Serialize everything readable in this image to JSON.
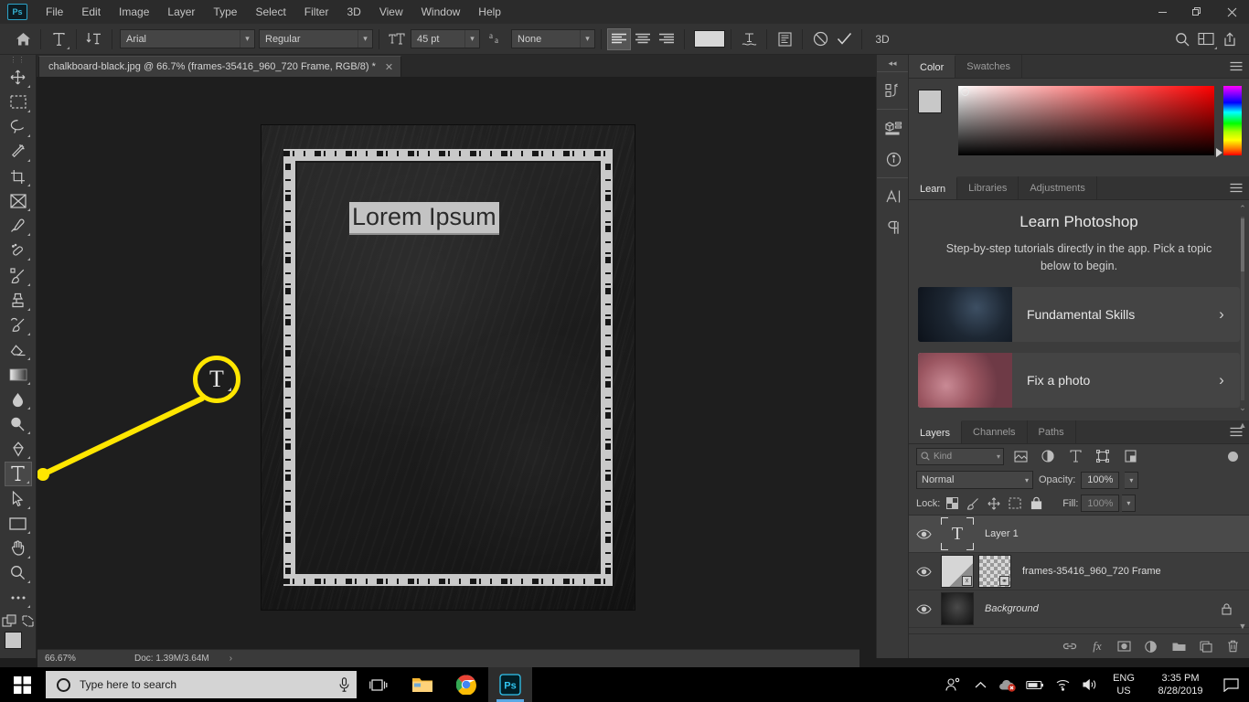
{
  "app": {
    "name": "Adobe Photoshop",
    "logo_text": "Ps"
  },
  "menubar": {
    "items": [
      "File",
      "Edit",
      "Image",
      "Layer",
      "Type",
      "Select",
      "Filter",
      "3D",
      "View",
      "Window",
      "Help"
    ],
    "window_controls": {
      "minimize": "–",
      "restore": "❐",
      "close": "✕"
    }
  },
  "options_bar": {
    "home_icon": "home-icon",
    "tool_preset": "type-tool-icon",
    "orientation": "toggle-text-orientation-icon",
    "font_family": "Arial",
    "font_style": "Regular",
    "size_icon": "font-size-icon",
    "font_size": "45 pt",
    "antialias_icon": "anti-aliasing-icon",
    "antialias_value": "None",
    "align_left": "align-left-icon",
    "align_center": "align-center-icon",
    "align_right": "align-right-icon",
    "color_swatch": "#d7d7d7",
    "warp_icon": "warp-text-icon",
    "panels_icon": "character-paragraph-panels-icon",
    "cancel_icon": "⊘",
    "commit_icon": "✓",
    "threed_label": "3D",
    "search_icon": "search-icon",
    "arrange_icon": "arrange-documents-icon",
    "share_icon": "share-icon"
  },
  "document": {
    "tab_title": "chalkboard-black.jpg @ 66.7%  (frames-35416_960_720 Frame, RGB/8) *",
    "close_label": "✕",
    "canvas_text": "Lorem Ipsum"
  },
  "toolbar": {
    "tools": [
      {
        "name": "move-tool",
        "icon": "move"
      },
      {
        "name": "rectangular-marquee-tool",
        "icon": "marquee"
      },
      {
        "name": "lasso-tool",
        "icon": "lasso"
      },
      {
        "name": "magic-wand-tool",
        "icon": "wand"
      },
      {
        "name": "crop-tool",
        "icon": "crop"
      },
      {
        "name": "frame-tool",
        "icon": "frame"
      },
      {
        "name": "eyedropper-tool",
        "icon": "eyedropper"
      },
      {
        "name": "spot-healing-brush-tool",
        "icon": "healing"
      },
      {
        "name": "brush-tool",
        "icon": "brush"
      },
      {
        "name": "clone-stamp-tool",
        "icon": "stamp"
      },
      {
        "name": "history-brush-tool",
        "icon": "historybrush"
      },
      {
        "name": "eraser-tool",
        "icon": "eraser"
      },
      {
        "name": "gradient-tool",
        "icon": "gradient"
      },
      {
        "name": "blur-tool",
        "icon": "blur"
      },
      {
        "name": "dodge-tool",
        "icon": "dodge"
      },
      {
        "name": "pen-tool",
        "icon": "pen"
      },
      {
        "name": "horizontal-type-tool",
        "icon": "type",
        "selected": true
      },
      {
        "name": "path-selection-tool",
        "icon": "pathselect"
      },
      {
        "name": "rectangle-tool",
        "icon": "rectangle"
      },
      {
        "name": "hand-tool",
        "icon": "hand"
      },
      {
        "name": "zoom-tool",
        "icon": "zoom"
      },
      {
        "name": "edit-toolbar-tool",
        "icon": "more"
      }
    ],
    "quickmask_icon": "quick-mask-icon",
    "screenmode_icon": "screen-mode-icon",
    "foreground_color": "#c8c8c8",
    "background_color": "#c8c8c8"
  },
  "annotation": {
    "color": "#ffe600",
    "callout_letter": "T",
    "target": "horizontal-type-tool"
  },
  "status_bar": {
    "zoom": "66.67%",
    "doc_info": "Doc: 1.39M/3.64M",
    "expand_arrow": "›"
  },
  "dock_rail": {
    "collapse_icon": "«",
    "buttons": [
      {
        "name": "history-panel-icon"
      },
      {
        "name": "properties-3d-panel-icon"
      },
      {
        "name": "info-panel-icon"
      },
      {
        "name": "character-panel-icon"
      },
      {
        "name": "paragraph-panel-icon"
      }
    ]
  },
  "color_panel": {
    "tabs": [
      {
        "label": "Color",
        "active": true
      },
      {
        "label": "Swatches",
        "active": false
      }
    ],
    "menu_icon": "panel-menu-icon",
    "foreground": "#c8c8c8",
    "background": "#c8c8c8",
    "ramp_from": "#ffffff",
    "ramp_to": "#ff0000"
  },
  "learn_panel": {
    "tabs": [
      {
        "label": "Learn",
        "active": true
      },
      {
        "label": "Libraries",
        "active": false
      },
      {
        "label": "Adjustments",
        "active": false
      }
    ],
    "menu_icon": "panel-menu-icon",
    "heading": "Learn Photoshop",
    "description": "Step-by-step tutorials directly in the app. Pick a topic below to begin.",
    "cards": [
      {
        "label": "Fundamental Skills",
        "chevron": "›"
      },
      {
        "label": "Fix a photo",
        "chevron": "›"
      }
    ],
    "scroll_up": "⌃",
    "scroll_down": "⌄"
  },
  "layers_panel": {
    "tabs": [
      {
        "label": "Layers",
        "active": true
      },
      {
        "label": "Channels",
        "active": false
      },
      {
        "label": "Paths",
        "active": false
      }
    ],
    "menu_icon": "panel-menu-icon",
    "filter_placeholder": "Kind",
    "filter_icons": [
      "filter-pixel-icon",
      "filter-adjustment-icon",
      "filter-type-icon",
      "filter-shape-icon",
      "filter-smartobject-icon"
    ],
    "filter_toggle": "filter-enable-toggle",
    "blend_mode": "Normal",
    "opacity_label": "Opacity:",
    "opacity_value": "100%",
    "lock_label": "Lock:",
    "lock_icons": [
      "lock-transparent-pixels-icon",
      "lock-image-pixels-icon",
      "lock-position-icon",
      "lock-artboard-nesting-icon",
      "lock-all-icon"
    ],
    "fill_label": "Fill:",
    "fill_value": "100%",
    "layers": [
      {
        "name": "Layer 1",
        "type": "text",
        "visible": true,
        "selected": true,
        "locked": false,
        "italic": false
      },
      {
        "name": "frames-35416_960_720 Frame",
        "type": "frame",
        "visible": true,
        "selected": false,
        "locked": false,
        "italic": false
      },
      {
        "name": "Background",
        "type": "background",
        "visible": true,
        "selected": false,
        "locked": true,
        "italic": true
      }
    ],
    "bottom_buttons": [
      {
        "name": "link-layers-button",
        "glyph": "⚭"
      },
      {
        "name": "layer-style-button",
        "glyph": "fx"
      },
      {
        "name": "layer-mask-button",
        "glyph": "▣"
      },
      {
        "name": "adjustment-layer-button",
        "glyph": "◑"
      },
      {
        "name": "new-group-button",
        "glyph": "▰"
      },
      {
        "name": "new-layer-button",
        "glyph": "⧉"
      },
      {
        "name": "delete-layer-button",
        "glyph": "Ὕ1"
      }
    ]
  },
  "taskbar": {
    "start_icon": "windows-start-icon",
    "search_placeholder": "Type here to search",
    "mic_icon": "microphone-icon",
    "taskview_icon": "task-view-icon",
    "apps": [
      {
        "name": "file-explorer-icon",
        "active": false
      },
      {
        "name": "google-chrome-icon",
        "active": false
      },
      {
        "name": "photoshop-icon",
        "active": true,
        "label": "Ps"
      }
    ],
    "tray": {
      "people_icon": "people-icon",
      "expand_icon": "show-hidden-icons-icon",
      "onedrive_icon": "onedrive-error-icon",
      "battery_icon": "battery-icon",
      "wifi_icon": "wifi-icon",
      "volume_icon": "volume-icon",
      "language_line1": "ENG",
      "language_line2": "US",
      "time": "3:35 PM",
      "date": "8/28/2019",
      "action_center_icon": "action-center-icon"
    }
  }
}
